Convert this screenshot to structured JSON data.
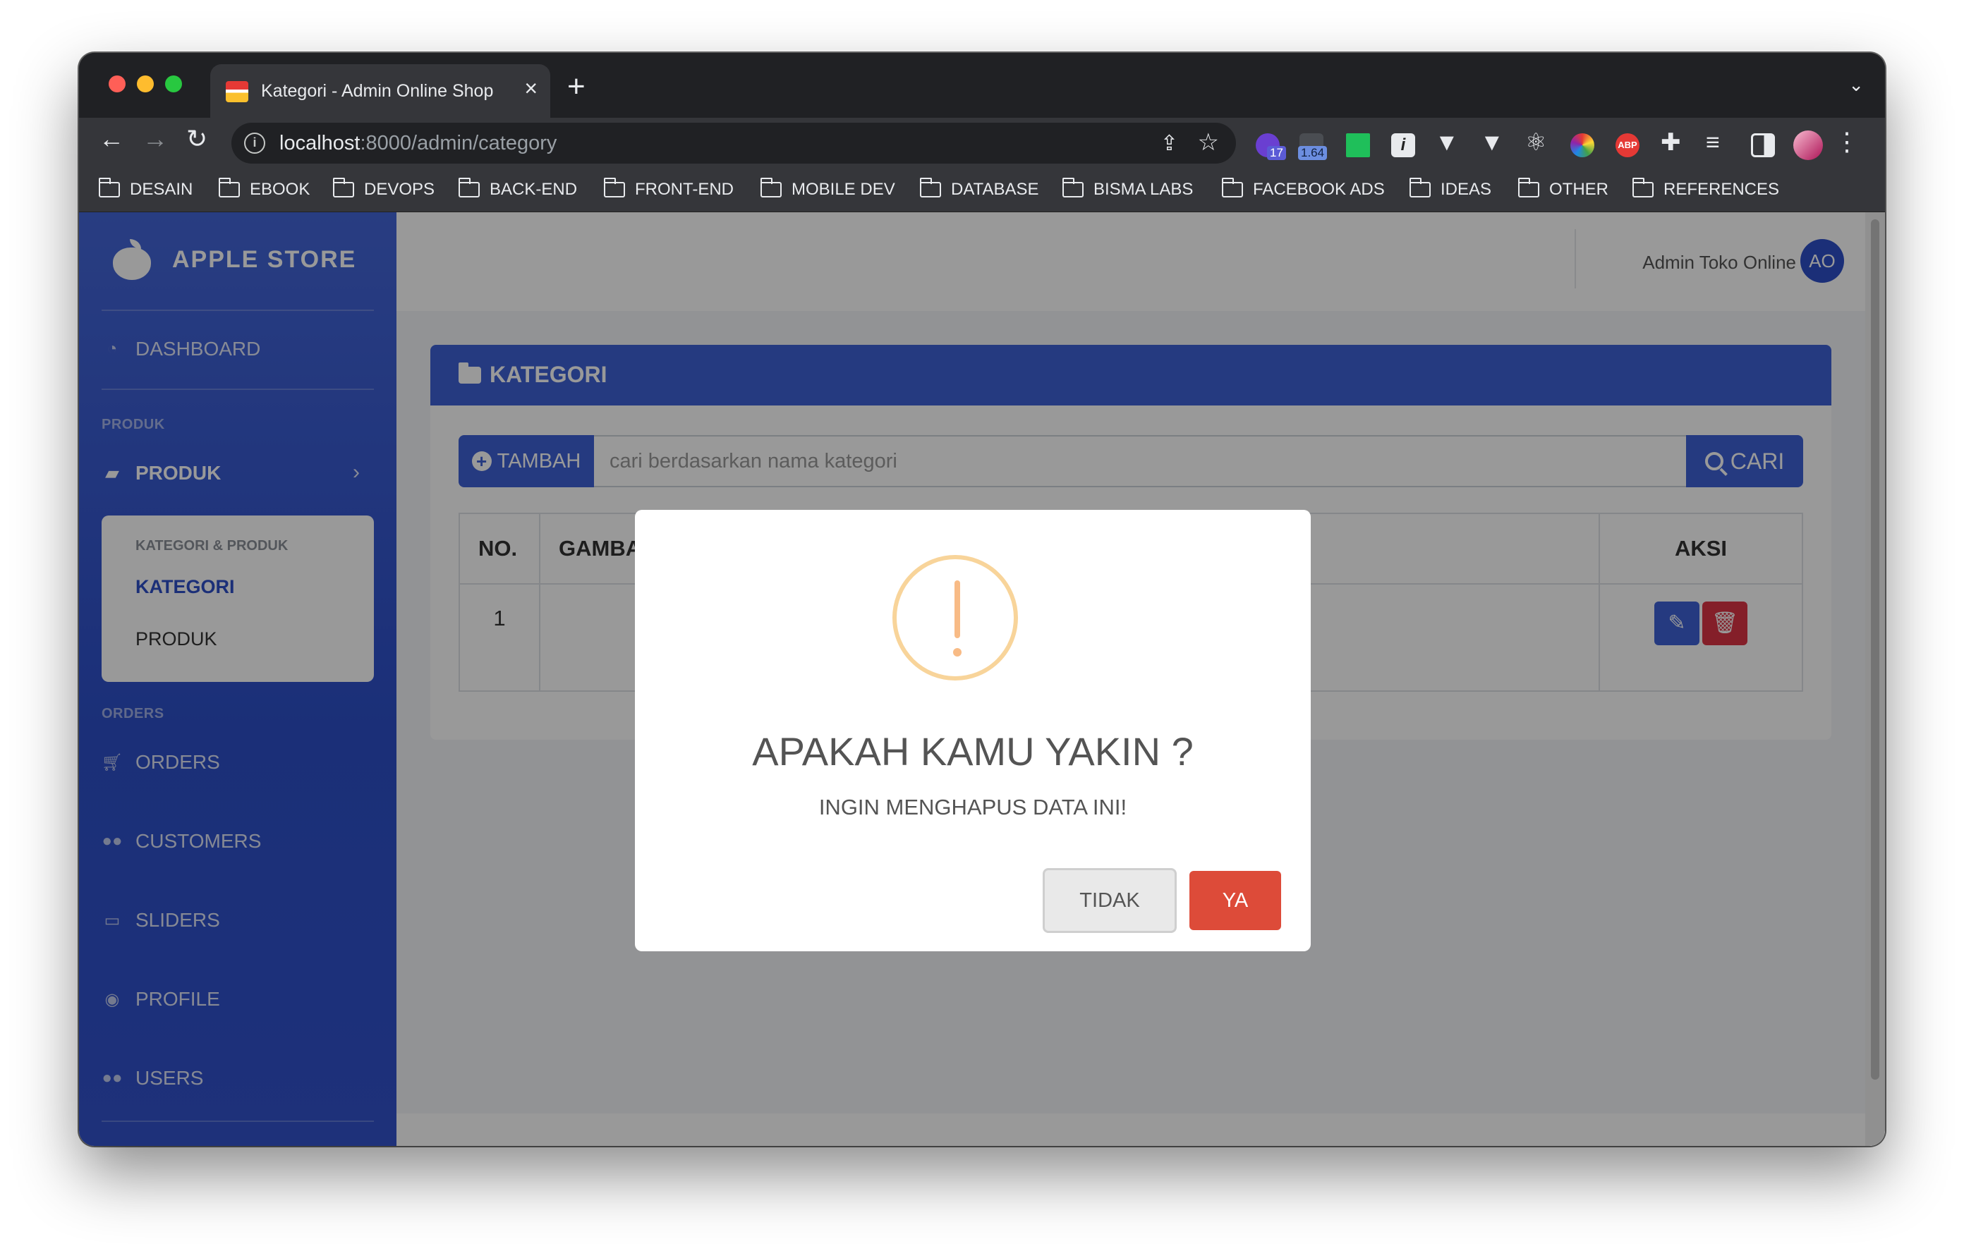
{
  "browser": {
    "tab_title": "Kategori - Admin Online Shop",
    "url_host": "localhost",
    "url_path": ":8000/admin/category",
    "extensions": [
      {
        "name": "extension-1-icon",
        "badge": "17"
      },
      {
        "name": "extension-2-icon",
        "badge": "1.64"
      }
    ],
    "bookmarks": [
      "DESAIN",
      "EBOOK",
      "DEVOPS",
      "BACK-END",
      "FRONT-END",
      "MOBILE DEV",
      "DATABASE",
      "BISMA LABS",
      "FACEBOOK ADS",
      "IDEAS",
      "OTHER",
      "REFERENCES"
    ]
  },
  "sidebar": {
    "brand": "APPLE STORE",
    "dashboard": "DASHBOARD",
    "section_produk": "PRODUK",
    "produk": "PRODUK",
    "submenu_head": "KATEGORI & PRODUK",
    "submenu_kategori": "KATEGORI",
    "submenu_produk": "PRODUK",
    "section_orders": "ORDERS",
    "orders": "ORDERS",
    "customers": "CUSTOMERS",
    "sliders": "SLIDERS",
    "profile": "PROFILE",
    "users": "USERS"
  },
  "topbar": {
    "user_name": "Admin Toko Online",
    "avatar_initials": "AO"
  },
  "card": {
    "title": "KATEGORI",
    "add_button": "TAMBAH",
    "search_placeholder": "cari berdasarkan nama kategori",
    "search_button": "CARI",
    "table": {
      "headers": [
        "NO.",
        "GAMBAR",
        "",
        "AKSI"
      ],
      "rows": [
        {
          "no": "1"
        }
      ]
    }
  },
  "modal": {
    "title": "APAKAH KAMU YAKIN ?",
    "text": "INGIN MENGHAPUS DATA INI!",
    "cancel": "TIDAK",
    "confirm": "YA"
  },
  "colors": {
    "sidebar": "#3a5bd3",
    "primary": "#3f62d6",
    "danger": "#dd4b39",
    "warning_ring": "#f8d49a"
  }
}
